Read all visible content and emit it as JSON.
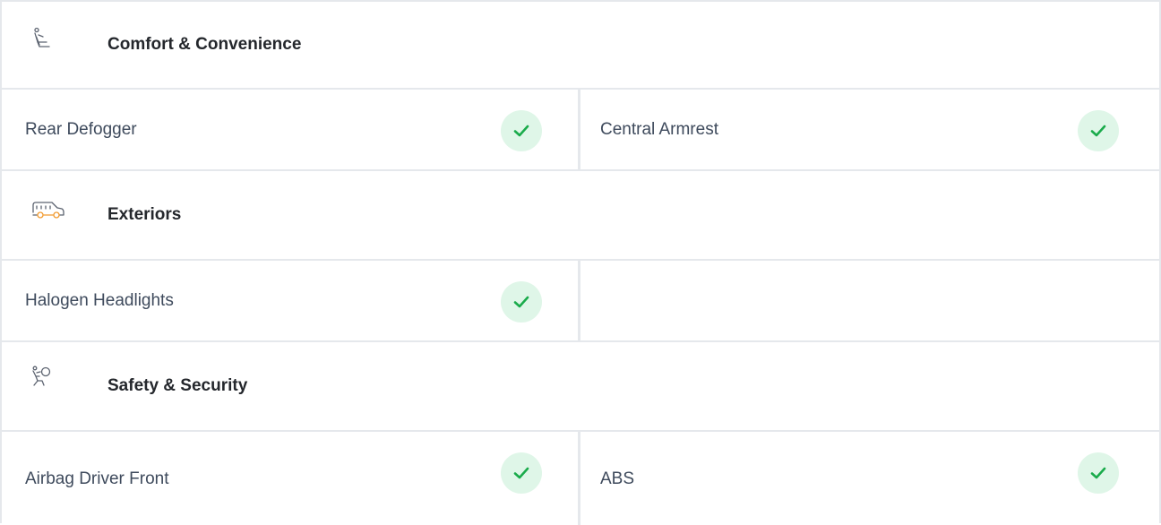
{
  "sections": [
    {
      "title": "Comfort & Convenience",
      "icon": "seat-icon",
      "rows": [
        {
          "left": "Rear Defogger",
          "right": "Central Armrest"
        }
      ]
    },
    {
      "title": "Exteriors",
      "icon": "car-icon",
      "rows": [
        {
          "left": "Halogen Headlights",
          "right": ""
        }
      ]
    },
    {
      "title": "Safety & Security",
      "icon": "airbag-icon",
      "rows": [
        {
          "left": "Airbag Driver Front",
          "right": "ABS"
        }
      ]
    }
  ],
  "colors": {
    "check_bg": "#dff6e8",
    "check_mark": "#1aab4b",
    "border": "#e5e8ec",
    "icon_stroke": "#5c6370",
    "icon_accent": "#f29a2e"
  }
}
